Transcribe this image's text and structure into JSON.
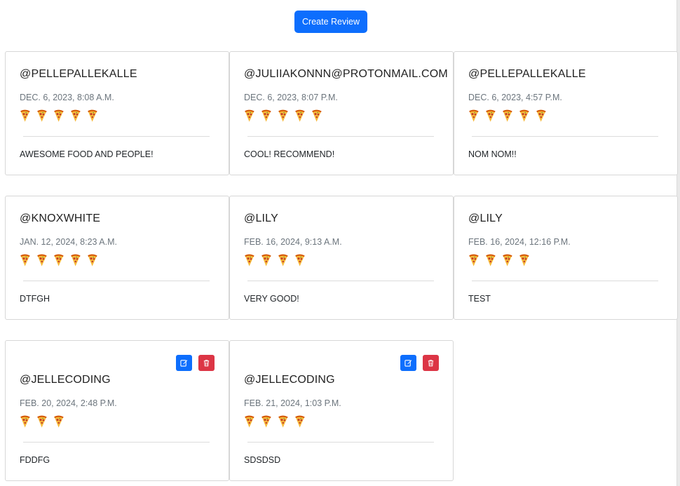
{
  "create_button_label": "Create Review",
  "rating_icon": "pizza-slice-icon",
  "reviews": [
    {
      "username": "@PELLEPALLEKALLE",
      "date": "DEC. 6, 2023, 8:08 A.M.",
      "rating": 5,
      "comment": "AWESOME FOOD AND PEOPLE!",
      "editable": false
    },
    {
      "username": "@JULIIAKONNN@PROTONMAIL.COM",
      "date": "DEC. 6, 2023, 8:07 P.M.",
      "rating": 5,
      "comment": "COOL! RECOMMEND!",
      "editable": false
    },
    {
      "username": "@PELLEPALLEKALLE",
      "date": "DEC. 6, 2023, 4:57 P.M.",
      "rating": 5,
      "comment": "NOM NOM!!",
      "editable": false
    },
    {
      "username": "@KNOXWHITE",
      "date": "JAN. 12, 2024, 8:23 A.M.",
      "rating": 5,
      "comment": "DTFGH",
      "editable": false
    },
    {
      "username": "@LILY",
      "date": "FEB. 16, 2024, 9:13 A.M.",
      "rating": 4,
      "comment": "VERY GOOD!",
      "editable": false
    },
    {
      "username": "@LILY",
      "date": "FEB. 16, 2024, 12:16 P.M.",
      "rating": 4,
      "comment": "TEST",
      "editable": false
    },
    {
      "username": "@JELLECODING",
      "date": "FEB. 20, 2024, 2:48 P.M.",
      "rating": 3,
      "comment": "FDDFG",
      "editable": true
    },
    {
      "username": "@JELLECODING",
      "date": "FEB. 21, 2024, 1:03 P.M.",
      "rating": 4,
      "comment": "SDSDSD",
      "editable": true
    }
  ],
  "colors": {
    "primary": "#0d6efd",
    "danger": "#dc3545",
    "muted": "#6c757d",
    "border": "#d7d7d7"
  }
}
